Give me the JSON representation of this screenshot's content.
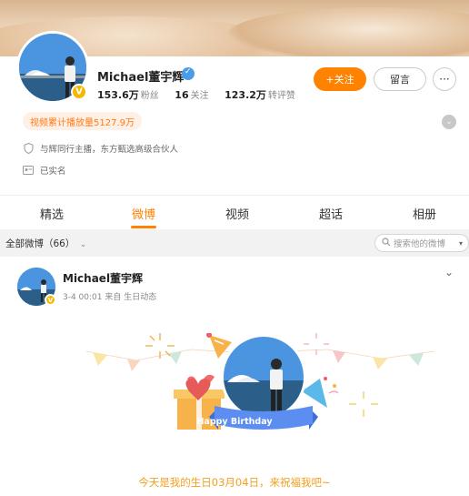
{
  "profile": {
    "name": "Michael董宇辉",
    "stats": [
      {
        "num": "153.6万",
        "label": "粉丝"
      },
      {
        "num": "16",
        "label": "关注"
      },
      {
        "num": "123.2万",
        "label": "转评赞"
      }
    ],
    "follow_label": "+关注",
    "message_label": "留言",
    "more_label": "···",
    "play_count": "视频累计播放量5127.9万",
    "info": [
      {
        "icon": "shield-icon",
        "text": "与辉同行主播，东方甄选高级合伙人"
      },
      {
        "icon": "id-card-icon",
        "text": "已实名"
      }
    ]
  },
  "tabs": [
    {
      "label": "精选",
      "active": false
    },
    {
      "label": "微博",
      "active": true
    },
    {
      "label": "视频",
      "active": false
    },
    {
      "label": "超话",
      "active": false
    },
    {
      "label": "相册",
      "active": false
    }
  ],
  "feed": {
    "filter_label": "全部微博（66）",
    "search_placeholder": "搜索他的微博"
  },
  "post": {
    "author": "Michael董宇辉",
    "meta": "3-4 00:01  来自 生日动态",
    "card_ribbon": "Happy Birthday",
    "birthday_text": "今天是我的生日03月04日，来祝福我吧~"
  },
  "colors": {
    "accent": "#ff8200",
    "verified_blue": "#4a9be8",
    "vip_gold": "#f5b700",
    "birthday_text": "#f4a020"
  }
}
